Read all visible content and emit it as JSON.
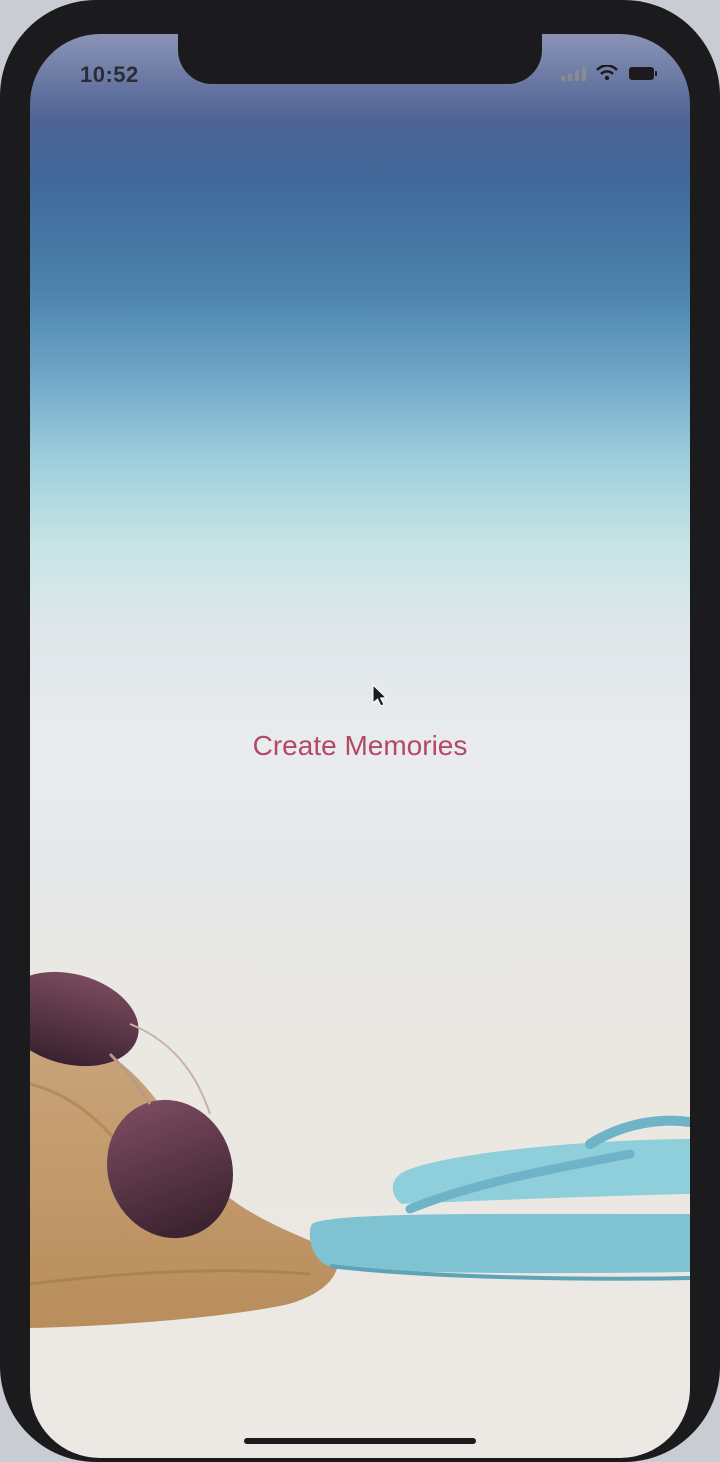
{
  "status_bar": {
    "time": "10:52"
  },
  "main": {
    "button_label": "Create Memories"
  },
  "colors": {
    "button_text": "#b24a63",
    "sky": "#4f6395",
    "sand": "#ece9e5",
    "flipflop": "#7fc3d3"
  }
}
